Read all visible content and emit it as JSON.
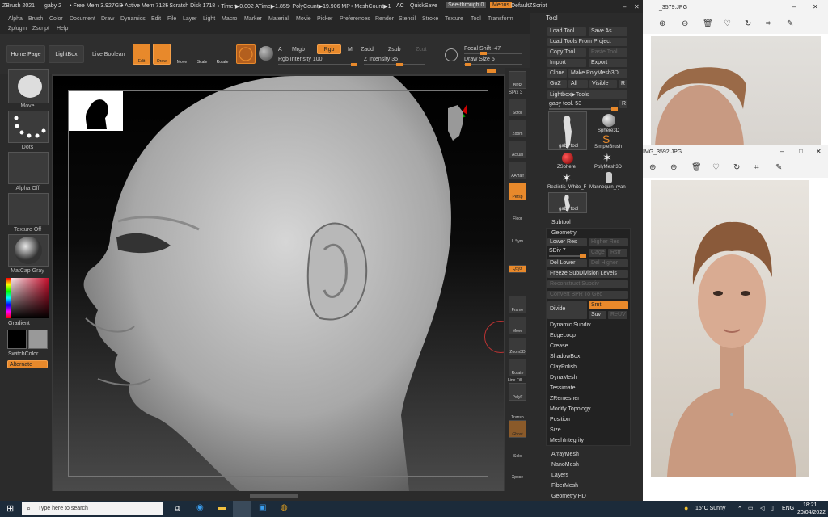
{
  "status": {
    "app": "ZBrush 2021",
    "doc": "gaby 2",
    "freemem": "• Free Mem 3.927GB",
    "activemem": "• Active Mem 7125",
    "scratch": "• Scratch Disk 1718",
    "timer": "• Timer▶0.002 ATime▶1.855",
    "polycount": "• PolyCount▶19.906 MP",
    "meshcount": "• MeshCount▶1",
    "ac": "AC",
    "quicksave": "QuickSave",
    "seethrough": "See-through  0",
    "menus": "Menus",
    "defaultzscript": "DefaultZScript"
  },
  "menu": {
    "row1": [
      "Alpha",
      "Brush",
      "Color",
      "Document",
      "Draw",
      "Dynamics",
      "Edit",
      "File",
      "Layer",
      "Light",
      "Macro",
      "Marker",
      "Material",
      "Movie",
      "Picker",
      "Preferences",
      "Render",
      "Stencil",
      "Stroke",
      "Texture",
      "Tool",
      "Transform"
    ],
    "row2": [
      "Zplugin",
      "Zscript",
      "Help"
    ]
  },
  "toolbar": {
    "homepage": "Home Page",
    "lightbox": "LightBox",
    "livebool": "Live Boolean",
    "edit": "Edit",
    "draw": "Draw",
    "move": "Move",
    "scale": "Scale",
    "rotate": "Rotate",
    "a": "A",
    "mrgb": "Mrgb",
    "rgb": "Rgb",
    "m": "M",
    "zadd": "Zadd",
    "zsub": "Zsub",
    "zcut": "Zcut",
    "rgbintensity": "Rgb Intensity 100",
    "zintensity": "Z Intensity 35",
    "focalshift": "Focal Shift -47",
    "drawsize": "Draw Size 5"
  },
  "left": {
    "move": "Move",
    "dots": "Dots",
    "alphaoff": "Alpha Off",
    "textureoff": "Texture Off",
    "matcap": "MatCap Gray",
    "gradient": "Gradient",
    "switchcolor": "SwitchColor",
    "alternate": "Alternate"
  },
  "right": {
    "bpr": "BPR",
    "spix": "SPix 3",
    "scroll": "Scroll",
    "zoom": "Zoom",
    "actual": "Actual",
    "aahalf": "AAHalf",
    "persp": "Persp",
    "floor": "Floor",
    "lsym": "L.Sym",
    "xyz": "Qxyz",
    "frame": "Frame",
    "movebtn": "Move",
    "zoom3d": "Zoom3D",
    "rotate": "Rotate",
    "linefill": "Line Fill",
    "polyf": "PolyF",
    "transp": "Transp",
    "ghost": "Ghost",
    "solo": "Solo",
    "xpose": "Xpose"
  },
  "tool": {
    "title": "Tool",
    "loadtool": "Load Tool",
    "saveas": "Save As",
    "loadfromproject": "Load Tools From Project",
    "copytool": "Copy Tool",
    "pastetool": "Paste Tool",
    "import": "Import",
    "export": "Export",
    "clone": "Clone",
    "makepolymesh": "Make PolyMesh3D",
    "goz": "GoZ",
    "all": "All",
    "visible": "Visible",
    "r": "R",
    "lightboxtools": "Lightbox▶Tools",
    "gabytool": "gaby tool. 53",
    "thumbs": [
      "gaby tool",
      "Sphere3D",
      "SimpleBrush",
      "ZSphere",
      "PolyMesh3D",
      "Realistic_White_F",
      "Mannequin_ryan",
      "gaby tool"
    ],
    "subtool": "Subtool",
    "geometry": "Geometry",
    "lowerres": "Lower Res",
    "higherres": "Higher Res",
    "sdiv": "SDiv 7",
    "cage": "Cage",
    "rstr": "Rstr",
    "dellower": "Del Lower",
    "delhigher": "Del Higher",
    "freeze": "Freeze SubDivision Levels",
    "reconstruct": "Reconstruct Subdiv",
    "convertbpr": "Convert BPR To Geo",
    "divide": "Divide",
    "smt": "Smt",
    "suv": "Suv",
    "reuv": "ReUV",
    "items": [
      "Dynamic Subdiv",
      "EdgeLoop",
      "Crease",
      "ShadowBox",
      "ClayPolish",
      "DynaMesh",
      "Tessimate",
      "ZRemesher",
      "Modify Topology",
      "Position",
      "Size",
      "MeshIntegrity"
    ],
    "more": [
      "ArrayMesh",
      "NanoMesh",
      "Layers",
      "FiberMesh",
      "Geometry HD"
    ]
  },
  "viewer1": {
    "title": "_3579.JPG"
  },
  "viewer2": {
    "title": "IMG_3592.JPG"
  },
  "taskbar": {
    "search": "Type here to search",
    "temp": "15°C  Sunny",
    "lang": "ENG",
    "time": "18:21",
    "date": "20/04/2022"
  }
}
